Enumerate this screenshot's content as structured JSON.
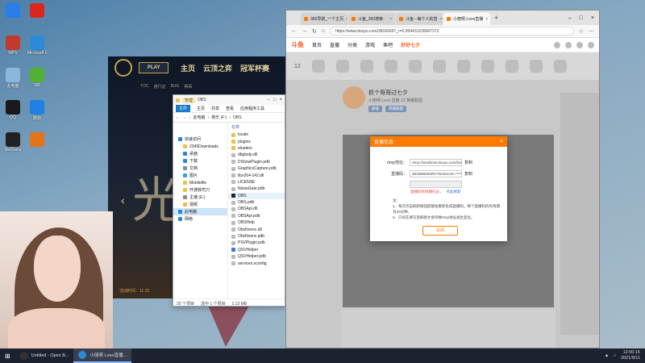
{
  "desktop": {
    "icons": [
      {
        "label": "",
        "color": "#2b7de9"
      },
      {
        "label": "",
        "color": "#d9271e"
      },
      {
        "label": "WPS",
        "color": "#c23a2a"
      },
      {
        "label": "Microsoft Edge",
        "color": "#2c8ad8"
      },
      {
        "label": "此电脑",
        "color": "#8db6dd"
      },
      {
        "label": "360",
        "color": "#51b133"
      },
      {
        "label": "QQ",
        "color": "#1a1a1a"
      },
      {
        "label": "酷狗",
        "color": "#1f7fe3"
      },
      {
        "label": "WeGame",
        "color": "#222"
      },
      {
        "label": "",
        "color": "#e5731c"
      }
    ]
  },
  "game": {
    "play": "PLAY",
    "nav": [
      "主页",
      "云顶之弈",
      "冠军杯赛"
    ],
    "sub": [
      "TOC",
      "通行证",
      "BUG",
      "赛事"
    ],
    "big_text": "光",
    "date": "活动时间：11.15"
  },
  "explorer": {
    "title": "OBS",
    "manage": "管理",
    "ribbon": [
      "文件",
      "主页",
      "共享",
      "查看",
      "应用程序工具"
    ],
    "crumbs": [
      "此电脑",
      "娱乐 (F:)",
      "OBS"
    ],
    "nav_items": [
      {
        "label": "快速访问",
        "color": "#2a86d6",
        "indent": false,
        "sel": false
      },
      {
        "label": "2345Downloads",
        "color": "#e8c04a",
        "indent": true,
        "sel": false
      },
      {
        "label": "桌面",
        "color": "#2a86d6",
        "indent": true,
        "sel": false
      },
      {
        "label": "下载",
        "color": "#2a86d6",
        "indent": true,
        "sel": false
      },
      {
        "label": "文档",
        "color": "#7c8ea8",
        "indent": true,
        "sel": false
      },
      {
        "label": "图片",
        "color": "#3aa3d8",
        "indent": true,
        "sel": false
      },
      {
        "label": "Mobilefile",
        "color": "#e8c04a",
        "indent": true,
        "sel": false
      },
      {
        "label": "开通铁司刀",
        "color": "#e8c04a",
        "indent": true,
        "sel": false
      },
      {
        "label": "主播 (E:)",
        "color": "#8a8a8a",
        "indent": true,
        "sel": false
      },
      {
        "label": "视频",
        "color": "#e8c04a",
        "indent": true,
        "sel": false
      },
      {
        "label": "此电脑",
        "color": "#2a86d6",
        "indent": false,
        "sel": true
      },
      {
        "label": "网络",
        "color": "#2a86d6",
        "indent": false,
        "sel": false
      }
    ],
    "files_header": "名称",
    "files": [
      {
        "name": "locale",
        "color": "#e8c04a"
      },
      {
        "name": "plugins",
        "color": "#e8c04a"
      },
      {
        "name": "shaders",
        "color": "#e8c04a"
      },
      {
        "name": "dbghelp.dll",
        "color": "#bbb"
      },
      {
        "name": "DShowPlugin.pdb",
        "color": "#bbb"
      },
      {
        "name": "GraphicsCapture.pdb",
        "color": "#bbb"
      },
      {
        "name": "libx264-142.dll",
        "color": "#bbb"
      },
      {
        "name": "LICENSE",
        "color": "#bbb"
      },
      {
        "name": "NoiseGate.pdb",
        "color": "#bbb"
      },
      {
        "name": "OBS",
        "color": "#222"
      },
      {
        "name": "OBS.pdb",
        "color": "#bbb"
      },
      {
        "name": "OBSApi.dll",
        "color": "#bbb"
      },
      {
        "name": "OBSApi.pdb",
        "color": "#bbb"
      },
      {
        "name": "OBSHelp",
        "color": "#bbb"
      },
      {
        "name": "ObsNvenc.dll",
        "color": "#bbb"
      },
      {
        "name": "ObsNvenc.pdb",
        "color": "#bbb"
      },
      {
        "name": "PSVPlugin.pdb",
        "color": "#bbb"
      },
      {
        "name": "QSVHelper",
        "color": "#3a7bd5"
      },
      {
        "name": "QSVHelper.pdb",
        "color": "#bbb"
      },
      {
        "name": "services.xconfig",
        "color": "#bbb"
      }
    ],
    "selected_file": "OBS",
    "status_items": "20 个项目",
    "status_selected": "选中 1 个项目",
    "status_size": "1.13 MB"
  },
  "browser": {
    "tabs": [
      {
        "title": "360导航_一个主页",
        "active": false
      },
      {
        "title": "斗鱼_360搜索",
        "active": false
      },
      {
        "title": "斗鱼 - 每个人的直",
        "active": false
      },
      {
        "title": "小丽呀.Lovo直播",
        "active": true
      }
    ],
    "url": "https://www.douyu.com/3816665?_r=0.954431228007373",
    "site_logo": "斗鱼",
    "site_nav": [
      "首页",
      "直播",
      "分类",
      "游戏",
      "鱼吧",
      "好好七夕"
    ],
    "counter": "12",
    "anchor_name": "抓个哥哥过七夕",
    "anchor_meta": "小丽呀.Lovo 直播  12  英雄联盟",
    "anchor_tags": [
      "颜值",
      "英雄联盟"
    ]
  },
  "modal": {
    "title": "直播信息",
    "close": "×",
    "rows": [
      {
        "label": "rtmp地址：",
        "value": "rtmp://sendtc3a.douyu.com/live",
        "action": "复制"
      },
      {
        "label": "直播码：",
        "value": "3816665r8eRH?wsSecret=************",
        "action": "复制"
      },
      {
        "label": "",
        "value": "",
        "action": ""
      }
    ],
    "warn": "直播码有效期已过，",
    "warn_link": "点此刷新",
    "notes_title": "注：",
    "notes": [
      "1、每次点击刷新按钮后都会重新生成直播码，每个直播码的有效期为30分钟。",
      "2、只有在填写后刷新才会导致rtmp地址发生变化。"
    ],
    "button": "关闭"
  },
  "taskbar": {
    "apps": [
      {
        "label": "Untitled - Open B...",
        "color": "#333",
        "active": false
      },
      {
        "label": "小丽呀.Lovo直播...",
        "color": "#2c8ad8",
        "active": true
      }
    ],
    "time": "12:00:15",
    "date": "2021/8/11"
  }
}
